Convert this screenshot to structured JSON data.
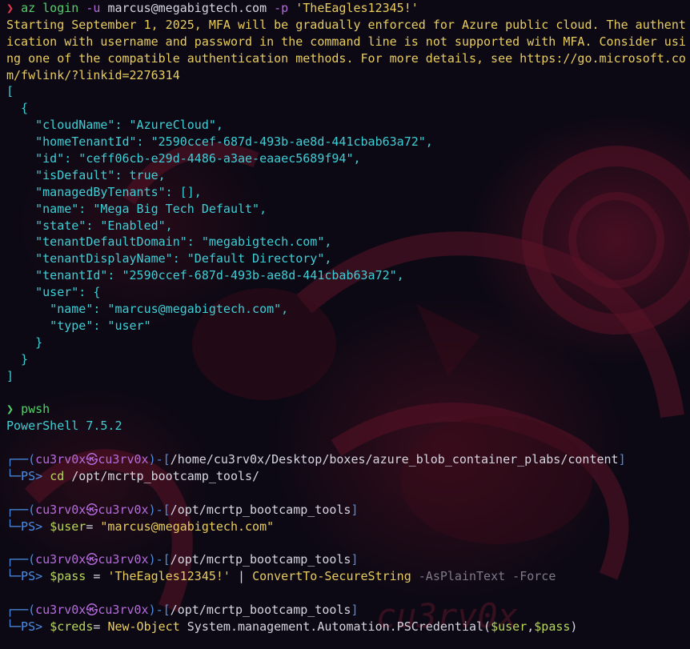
{
  "colors": {
    "background": "#0d0914",
    "warning": "#e8cd60",
    "json": "#3ecfd6",
    "prompt": "#4a8ee6",
    "user": "#b56cdc",
    "command": "#55d06a",
    "string": "#e8cd60"
  },
  "login": {
    "prompt_glyph": "❯",
    "cmd": "az login",
    "flag_u": "-u",
    "user": "marcus@megabigtech.com",
    "flag_p": "-p",
    "password": "'TheEagles12345!'"
  },
  "warning": [
    "Starting September 1, 2025, MFA will be gradually enforced for Azure public cloud. The authent",
    "ication with username and password in the command line is not supported with MFA. Consider usi",
    "ng one of the compatible authentication methods. For more details, see https://go.microsoft.co",
    "m/fwlink/?linkid=2276314"
  ],
  "json_output": [
    "[",
    "  {",
    "    \"cloudName\": \"AzureCloud\",",
    "    \"homeTenantId\": \"2590ccef-687d-493b-ae8d-441cbab63a72\",",
    "    \"id\": \"ceff06cb-e29d-4486-a3ae-eaaec5689f94\",",
    "    \"isDefault\": true,",
    "    \"managedByTenants\": [],",
    "    \"name\": \"Mega Big Tech Default\",",
    "    \"state\": \"Enabled\",",
    "    \"tenantDefaultDomain\": \"megabigtech.com\",",
    "    \"tenantDisplayName\": \"Default Directory\",",
    "    \"tenantId\": \"2590ccef-687d-493b-ae8d-441cbab63a72\",",
    "    \"user\": {",
    "      \"name\": \"marcus@megabigtech.com\",",
    "      \"type\": \"user\"",
    "    }",
    "  }",
    "]"
  ],
  "pwsh": {
    "prompt_glyph": "❯",
    "cmd": "pwsh",
    "version": "PowerShell 7.5.2"
  },
  "ps": {
    "top_prefix": "┌──(",
    "user": "cu3rv0x",
    "at": "㉿",
    "host": "cu3rv0x",
    "mid": ")-[",
    "close": "]",
    "bottom_prefix": "└─PS> ",
    "blocks": [
      {
        "path": "/home/cu3rv0x/Desktop/boxes/azure_blob_container_plabs/content",
        "cmd": "cd",
        "args": " /opt/mcrtp_bootcamp_tools/"
      },
      {
        "path": "/opt/mcrtp_bootcamp_tools",
        "var": "$user",
        "op": "= ",
        "value": "\"marcus@megabigtech.com\""
      },
      {
        "path": "/opt/mcrtp_bootcamp_tools",
        "var": "$pass",
        "op": " = ",
        "value": "'TheEagles12345!'",
        "pipe": " | ",
        "cmdlet": "ConvertTo-SecureString",
        "params": " -AsPlainText -Force"
      },
      {
        "path": "/opt/mcrtp_bootcamp_tools",
        "var": "$creds",
        "op": "= ",
        "cmdlet": "New-Object",
        "type": " System.management.Automation.PSCredential(",
        "arg1": "$user",
        "comma": ",",
        "arg2": "$pass",
        "end": ")"
      }
    ]
  },
  "watermark": "cu3rv0x"
}
